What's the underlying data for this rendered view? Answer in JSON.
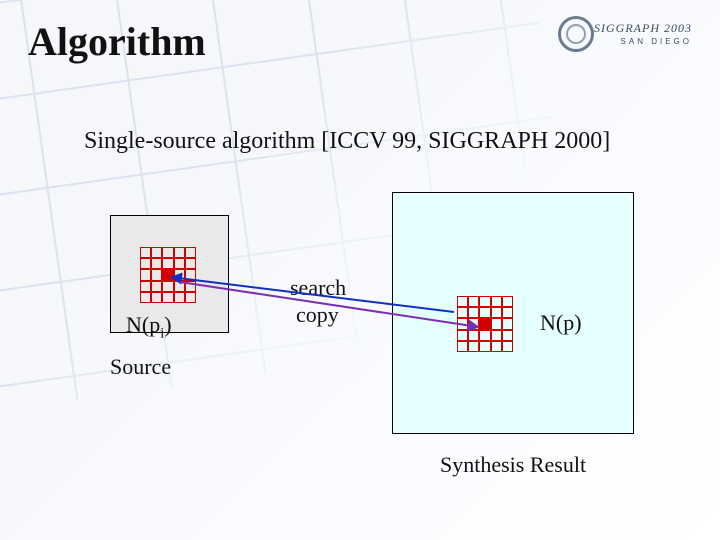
{
  "title": "Algorithm",
  "logo": {
    "line1": "SIGGRAPH 2003",
    "line2": "SAN DIEGO"
  },
  "subtitle": "Single-source algorithm [ICCV 99, SIGGRAPH 2000]",
  "labels": {
    "search": "search",
    "copy": "copy",
    "npi": "N(p",
    "npi_sub": "i",
    "npi_close": ")",
    "np": "N(p)",
    "source": "Source",
    "result": "Synthesis Result"
  }
}
